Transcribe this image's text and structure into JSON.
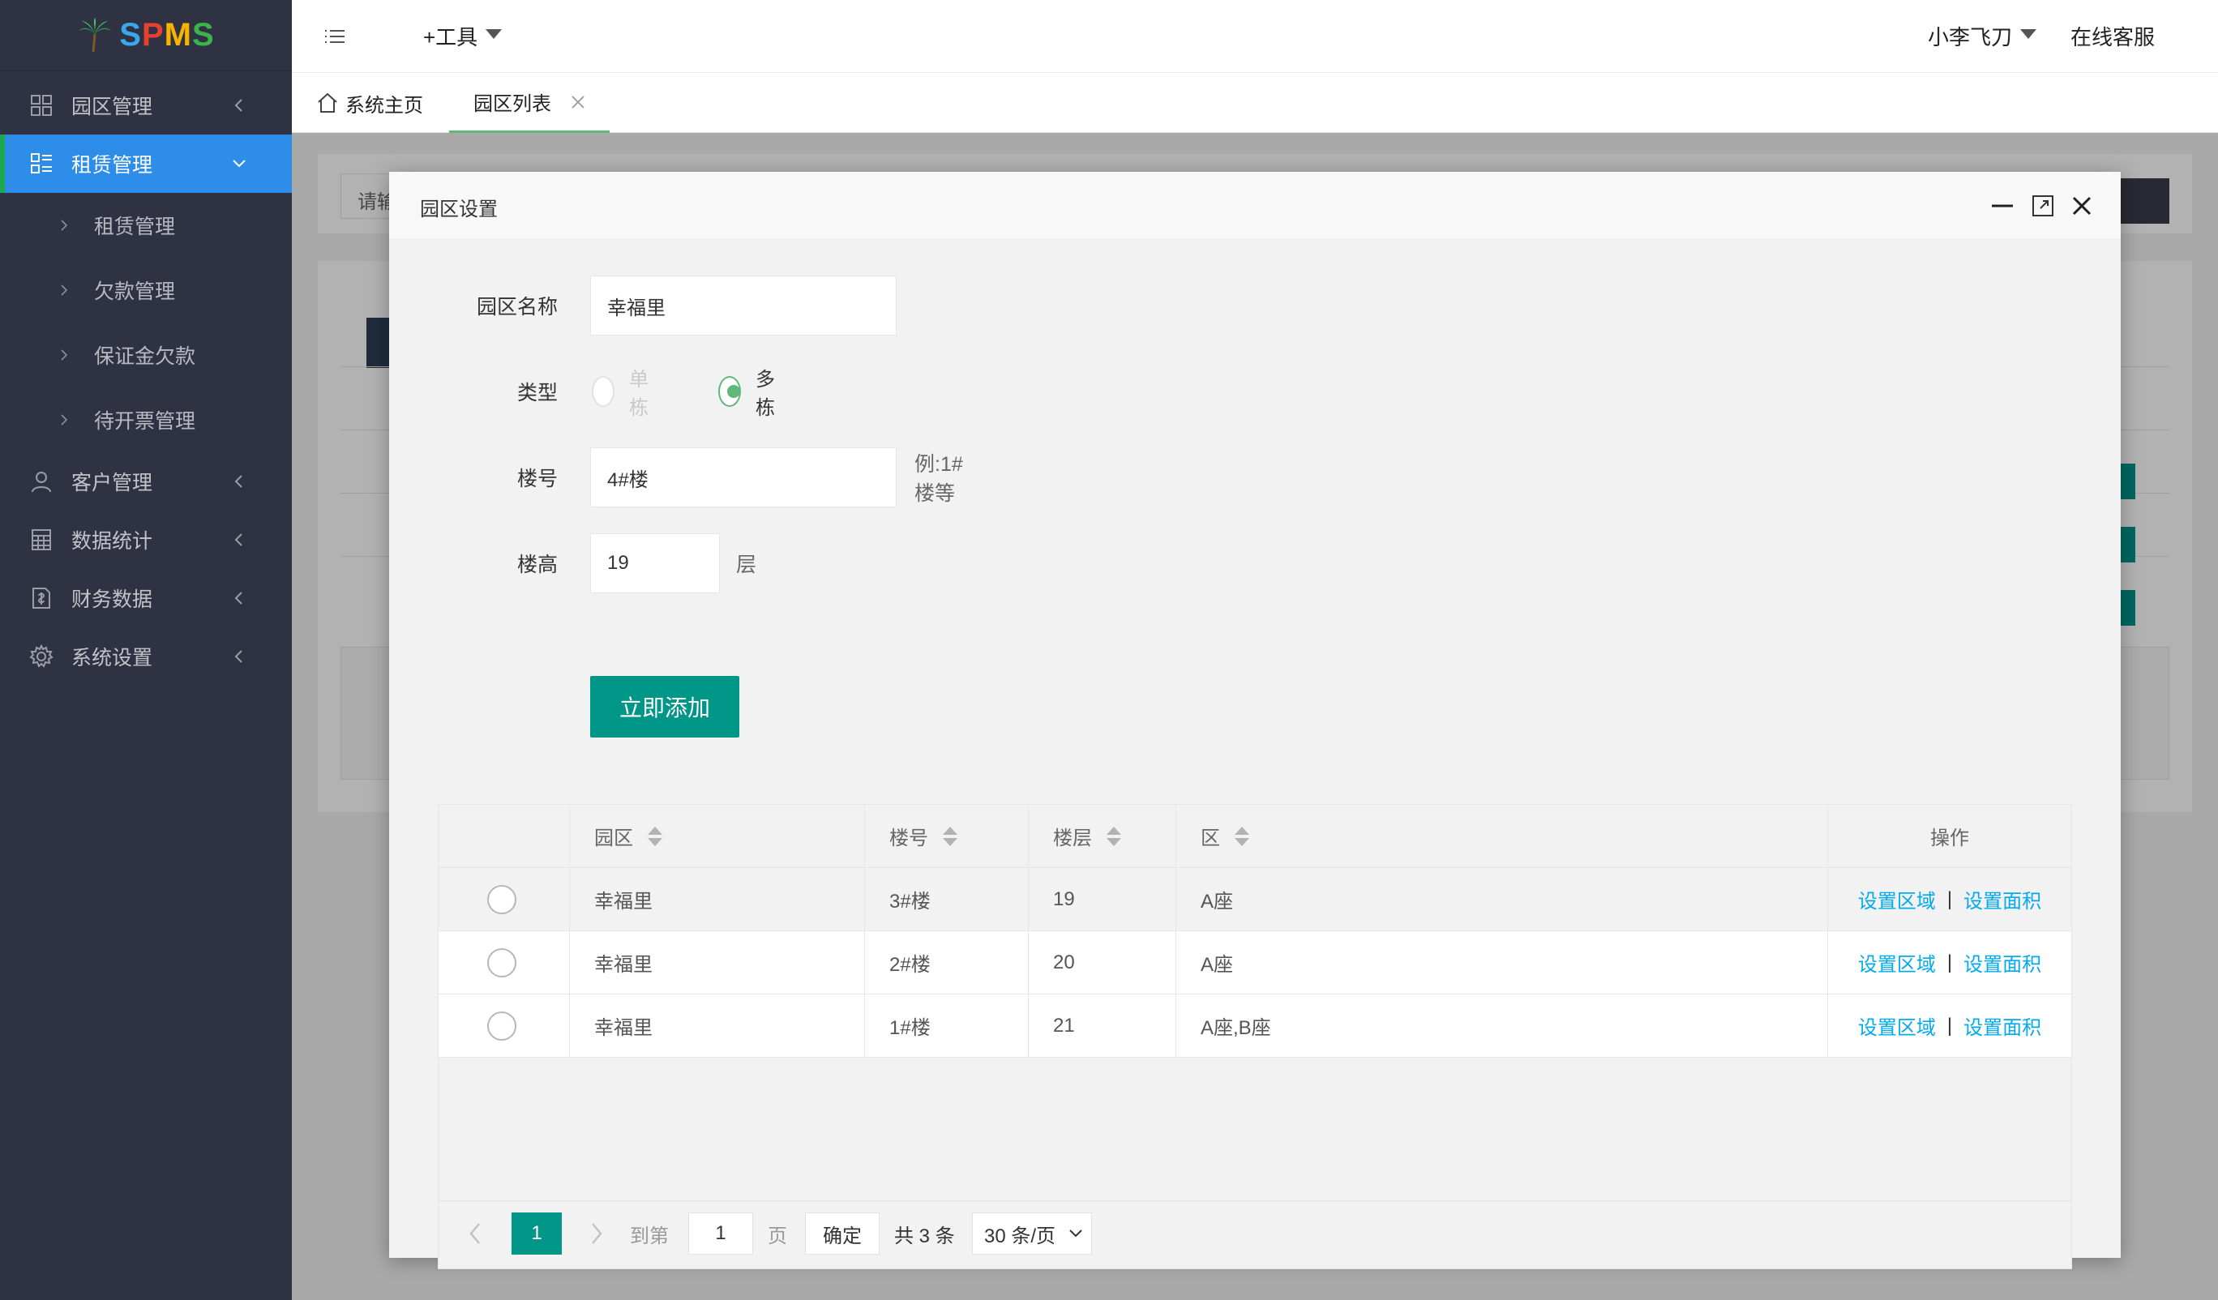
{
  "app": {
    "logo": "SPMS"
  },
  "sidebar": {
    "items": [
      {
        "label": "园区管理",
        "icon": "grid-icon"
      },
      {
        "label": "租赁管理",
        "icon": "list-icon",
        "active": true
      },
      {
        "label": "客户管理",
        "icon": "user-icon"
      },
      {
        "label": "数据统计",
        "icon": "calculator-icon"
      },
      {
        "label": "财务数据",
        "icon": "finance-icon"
      },
      {
        "label": "系统设置",
        "icon": "gear-icon"
      }
    ],
    "subitems": [
      {
        "label": "租赁管理"
      },
      {
        "label": "欠款管理"
      },
      {
        "label": "保证金欠款"
      },
      {
        "label": "待开票管理"
      }
    ]
  },
  "header": {
    "tools": "+工具",
    "user": "小李飞刀",
    "service": "在线客服"
  },
  "tabs": {
    "home": "系统主页",
    "active": "园区列表"
  },
  "background": {
    "search_placeholder": "请输"
  },
  "modal": {
    "title": "园区设置",
    "form": {
      "name_label": "园区名称",
      "name_value": "幸福里",
      "type_label": "类型",
      "type_options": [
        "单栋",
        "多栋"
      ],
      "type_selected": "多栋",
      "building_label": "楼号",
      "building_value": "4#楼",
      "building_hint": "例:1#楼等",
      "height_label": "楼高",
      "height_value": "19",
      "height_unit": "层",
      "submit": "立即添加"
    },
    "table": {
      "columns": [
        "园区",
        "楼号",
        "楼层",
        "区",
        "操作"
      ],
      "rows": [
        {
          "park": "幸福里",
          "building": "3#楼",
          "floors": "19",
          "zone": "A座"
        },
        {
          "park": "幸福里",
          "building": "2#楼",
          "floors": "20",
          "zone": "A座"
        },
        {
          "park": "幸福里",
          "building": "1#楼",
          "floors": "21",
          "zone": "A座,B座"
        }
      ],
      "action_area": "设置区域",
      "action_sep": "|",
      "action_size": "设置面积"
    },
    "pager": {
      "current": "1",
      "goto_label": "到第",
      "goto_value": "1",
      "page_unit": "页",
      "confirm": "确定",
      "total": "共 3 条",
      "page_size": "30 条/页"
    }
  },
  "colors": {
    "sidebar_bg": "#2f3243",
    "sidebar_active": "#2d8de8",
    "primary": "#009688",
    "radio_checked": "#5fb878",
    "link": "#01aaed"
  }
}
